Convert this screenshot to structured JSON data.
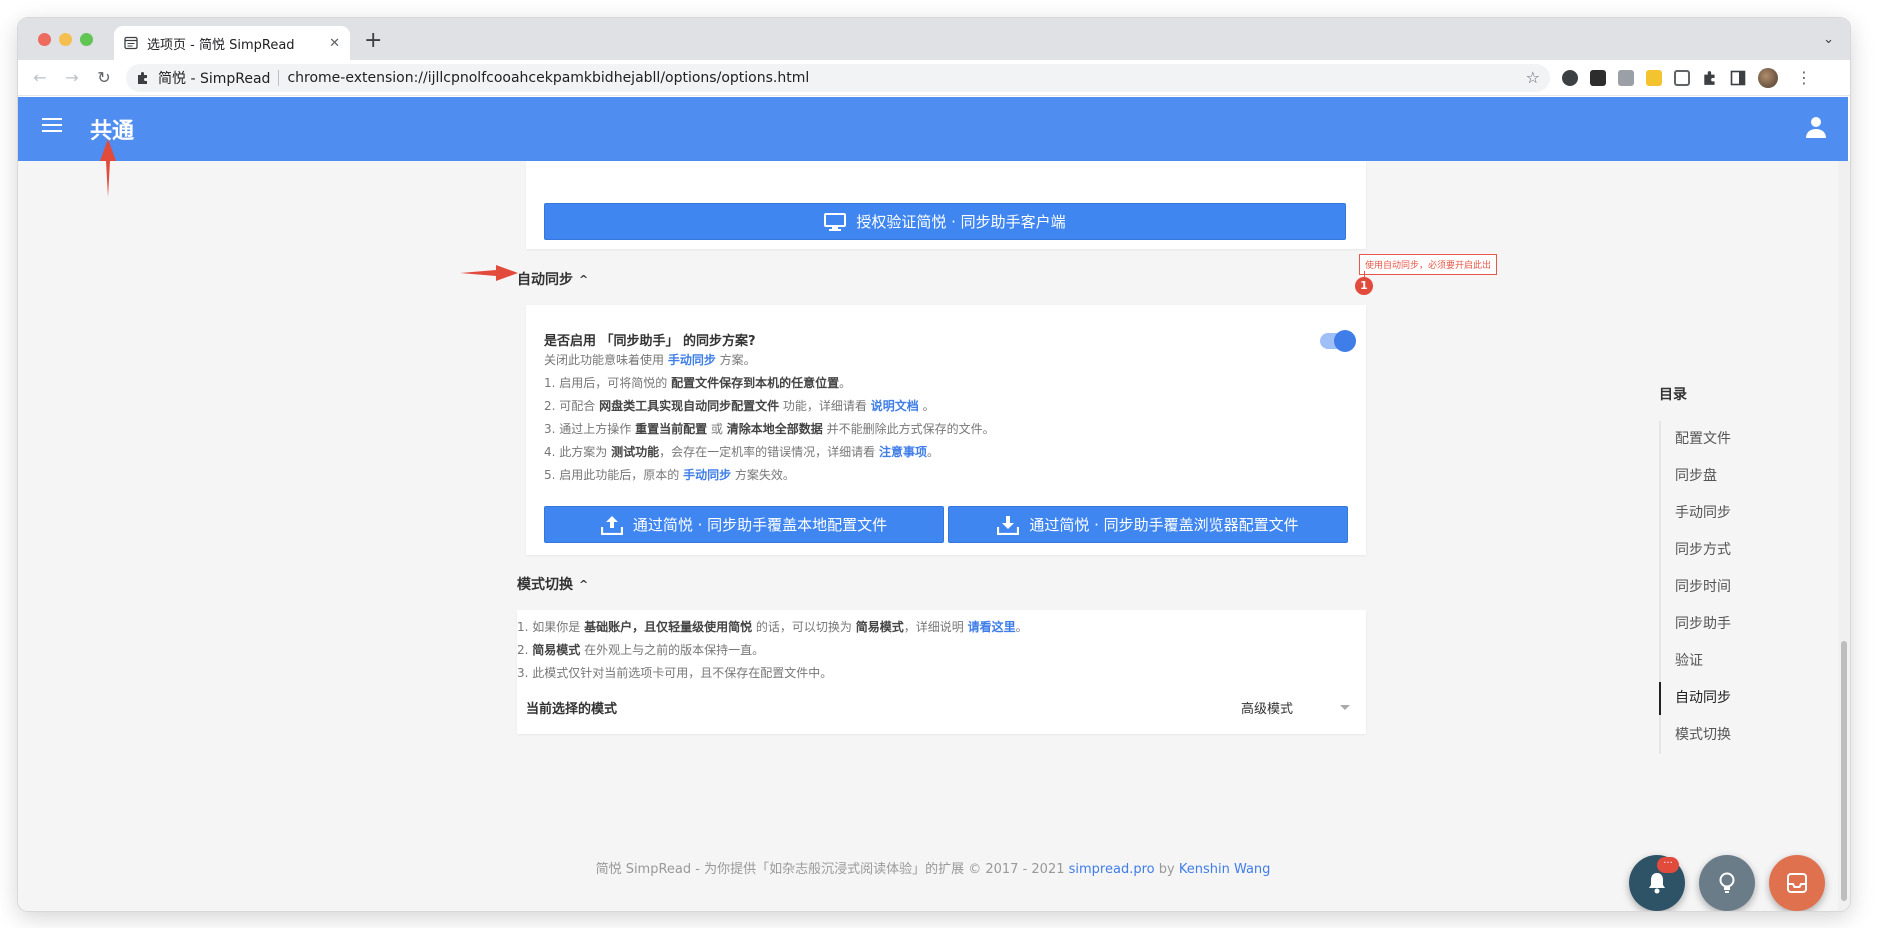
{
  "browser": {
    "tab_title": "选项页 - 简悦 SimpRead",
    "omnibox_site": "简悦 - SimpRead",
    "omnibox_url": "chrome-extension://ijllcpnolfcooahcekpamkbidhejabll/options/options.html"
  },
  "header": {
    "title": "共通"
  },
  "auth_button_label": "授权验证简悦 · 同步助手客户端",
  "auto_sync": {
    "heading": "自动同步",
    "setting_title": "是否启用 「同步助手」 的同步方案?",
    "tooltip": "使用自动同步，必须要开启此出",
    "badge": "1",
    "desc": {
      "l0a": "关闭此功能意味着使用 ",
      "l0b": "手动同步",
      "l0c": " 方案。",
      "l1a": "1. 启用后，可将简悦的 ",
      "l1b": "配置文件保存到本机的任意位置",
      "l1c": "。",
      "l2a": "2. 可配合 ",
      "l2b": "网盘类工具实现自动同步配置文件",
      "l2c": " 功能，详细请看 ",
      "l2d": "说明文档",
      "l2e": " 。",
      "l3a": "3. 通过上方操作 ",
      "l3b": "重置当前配置",
      "l3c": " 或 ",
      "l3d": "清除本地全部数据",
      "l3e": " 并不能删除此方式保存的文件。",
      "l4a": "4. 此方案为 ",
      "l4b": "测试功能",
      "l4c": "，会存在一定机率的错误情况，详细请看 ",
      "l4d": "注意事项",
      "l4e": "。",
      "l5a": "5. 启用此功能后，原本的 ",
      "l5b": "手动同步",
      "l5c": " 方案失效。"
    },
    "btn_local": "通过简悦 · 同步助手覆盖本地配置文件",
    "btn_browser": "通过简悦 · 同步助手覆盖浏览器配置文件"
  },
  "mode_switch": {
    "heading": "模式切换",
    "desc": {
      "l1a": "1. 如果你是 ",
      "l1b": "基础账户，且仅轻量级使用简悦",
      "l1c": " 的话，可以切换为 ",
      "l1d": "简易模式",
      "l1e": "，详细说明 ",
      "l1f": "请看这里",
      "l1g": "。",
      "l2a": "2. ",
      "l2b": "简易模式",
      "l2c": " 在外观上与之前的版本保持一直。",
      "l3": "3. 此模式仅针对当前选项卡可用，且不保存在配置文件中。"
    },
    "current_label": "当前选择的模式",
    "current_value": "高级模式"
  },
  "toc": {
    "title": "目录",
    "items": [
      "配置文件",
      "同步盘",
      "手动同步",
      "同步方式",
      "同步时间",
      "同步助手",
      "验证",
      "自动同步",
      "模式切换"
    ]
  },
  "footer": {
    "prefix": "简悦 SimpRead - 为你提供「如杂志般沉浸式阅读体验」的扩展 © 2017 - 2021 ",
    "site": "simpread.pro",
    "by": " by ",
    "author": "Kenshin Wang"
  },
  "fab": {
    "notify_badge": "···"
  },
  "colors": {
    "header_blue": "#4f8df0",
    "button_blue": "#3f86f1",
    "link_blue": "#3f7ee8",
    "annotation_red": "#e24b3b",
    "fab_dark": "#2f5366",
    "fab_gray": "#6b7c89",
    "fab_orange": "#e0714f"
  }
}
